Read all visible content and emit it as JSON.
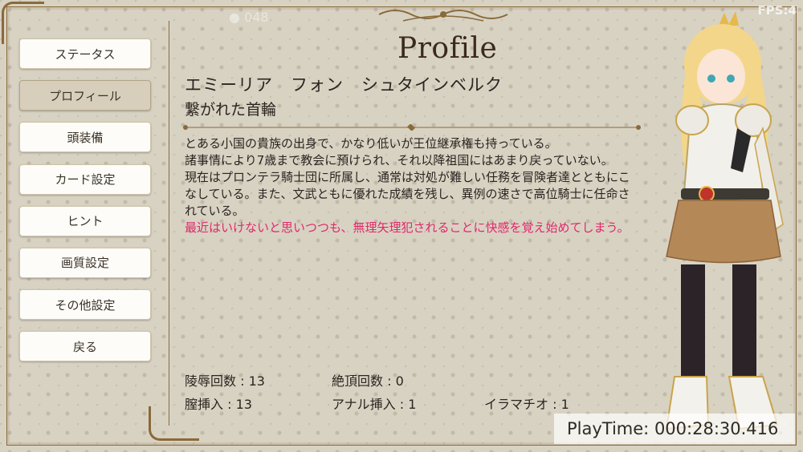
{
  "hud": {
    "coins": "048",
    "fps": "FPS:4"
  },
  "menu": [
    {
      "label": "ステータス",
      "active": false
    },
    {
      "label": "プロフィール",
      "active": true
    },
    {
      "label": "頭装備",
      "active": false
    },
    {
      "label": "カード設定",
      "active": false
    },
    {
      "label": "ヒント",
      "active": false
    },
    {
      "label": "画質設定",
      "active": false
    },
    {
      "label": "その他設定",
      "active": false
    },
    {
      "label": "戻る",
      "active": false
    }
  ],
  "profile": {
    "title": "Profile",
    "name": "エミーリア　フォン　シュタインベルク",
    "subtitle": "繋がれた首輪",
    "description": [
      "とある小国の貴族の出身で、かなり低いが王位継承権も持っている。",
      "諸事情により7歳まで教会に預けられ、それ以降祖国にはあまり戻っていない。",
      "現在はプロンテラ騎士団に所属し、通常は対処が難しい任務を冒険者達とともにこなしている。また、文武ともに優れた成績を残し、異例の速さで高位騎士に任命されている。"
    ],
    "description_highlight": "最近はいけないと思いつつも、無理矢理犯されることに快感を覚え始めてしまう。"
  },
  "stats": {
    "row1": [
      "陵辱回数 : 13",
      "絶頂回数 : 0"
    ],
    "row2": [
      "膣挿入 : 13",
      "アナル挿入 : 1",
      "イラマチオ : 1"
    ]
  },
  "playtime": "PlayTime: 000:28:30.416",
  "colors": {
    "accent": "#8a6a3a",
    "highlight": "#e0286a",
    "panel": "#d8d2c3"
  }
}
